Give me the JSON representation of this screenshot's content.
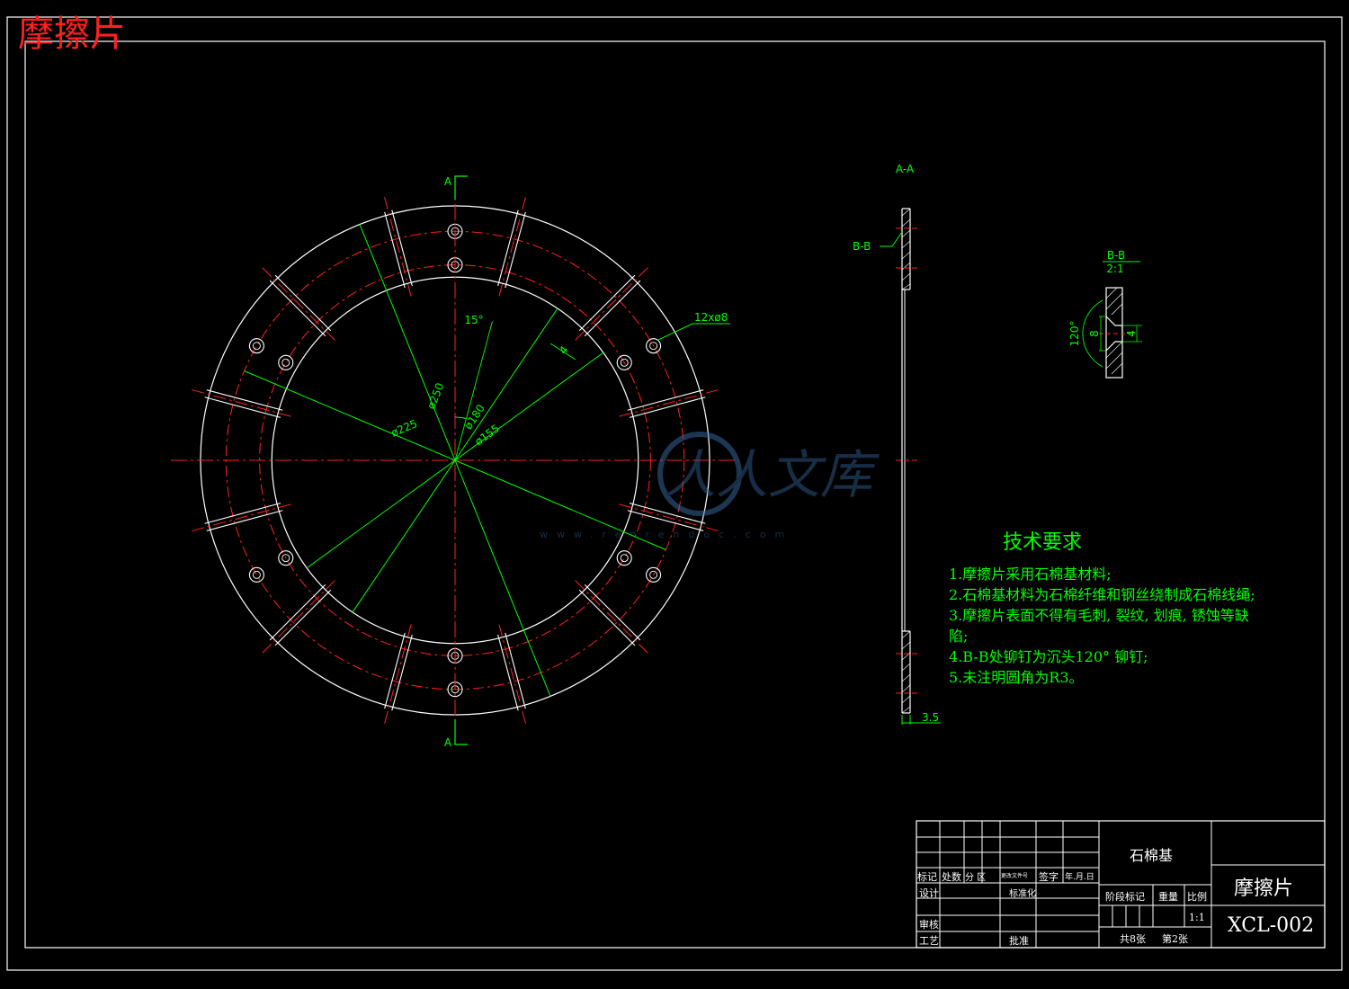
{
  "header": {
    "title": "摩擦片"
  },
  "views": {
    "section_label": "A-A",
    "cut_label_top": "A",
    "cut_label_bottom": "A",
    "detail_ref": "B-B",
    "detail_title": "B-B",
    "detail_scale": "2:1"
  },
  "dimensions": {
    "d250": "ø250",
    "d225": "ø225",
    "d180": "ø180",
    "d155": "ø155",
    "angle15": "15°",
    "width4": "4",
    "holes": "12xø8",
    "thickness": "3.5",
    "detail_angle": "120°",
    "detail_d8": "8",
    "detail_d4": "4"
  },
  "tech_requirements": {
    "heading": "技术要求",
    "lines": [
      "1.摩擦片采用石棉基材料;",
      "2.石棉基材料为石棉纤维和钢丝绕制成石棉线绳;",
      "3.摩擦片表面不得有毛刺, 裂纹, 划痕, 锈蚀等缺",
      "陷;",
      "4.B-B处铆钉为沉头120° 铆钉;",
      "5.未注明圆角为R3。"
    ]
  },
  "title_block": {
    "material": "石棉基",
    "part_name": "摩擦片",
    "drawing_no": "XCL-002",
    "scale": "1:1",
    "hdr_mark": "标记",
    "hdr_count": "处数",
    "hdr_zone": "分 区",
    "hdr_docno": "更改文件号",
    "hdr_sign": "签字",
    "hdr_date": "年.月.日",
    "lbl_design": "设计",
    "lbl_standard": "标准化",
    "lbl_check": "审核",
    "lbl_process": "工艺",
    "lbl_approve": "批准",
    "lbl_stage": "阶段标记",
    "lbl_weight": "重量",
    "lbl_scale": "比例",
    "sheets_total": "共8张",
    "sheet_no": "第2张"
  },
  "colors": {
    "outline": "#ffffff",
    "centerline": "#ff2020",
    "dimension": "#00ff00",
    "title": "#ff2020",
    "background": "#000000"
  }
}
